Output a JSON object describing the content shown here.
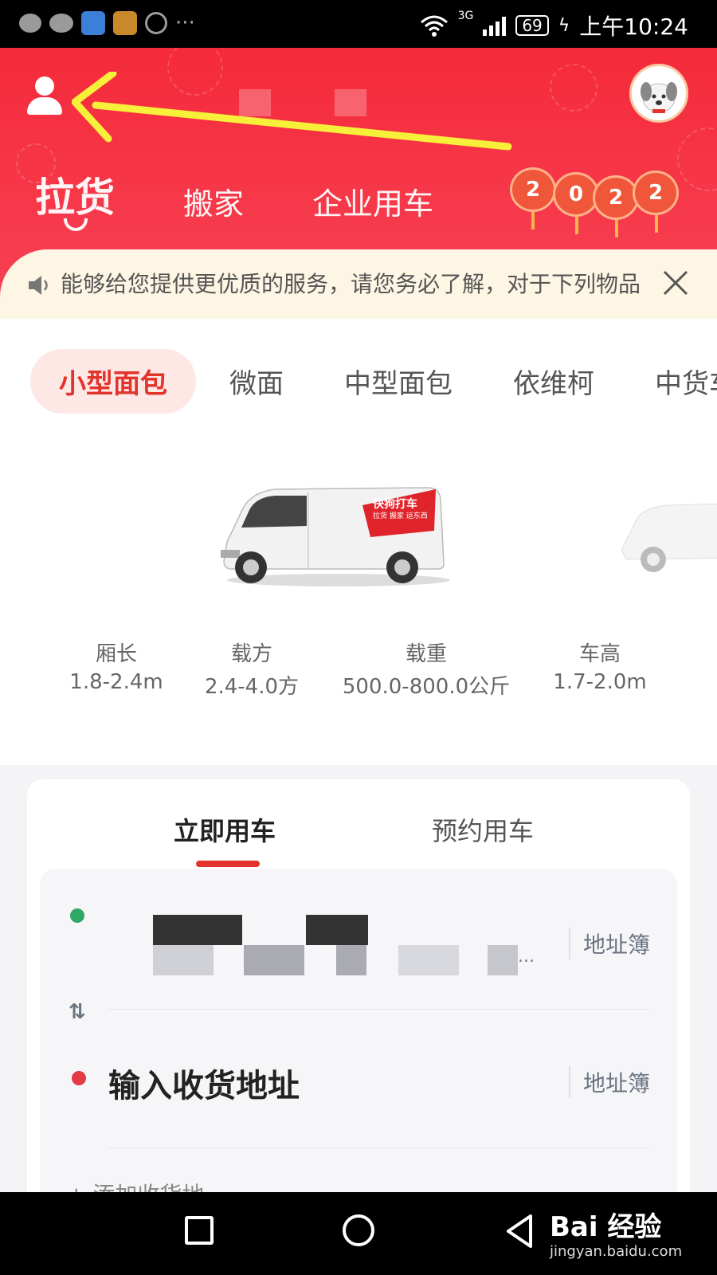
{
  "status_bar": {
    "time": "上午10:24",
    "battery": "69",
    "network": "3G",
    "more": "···"
  },
  "header": {
    "tabs": [
      {
        "label": "拉货",
        "active": true
      },
      {
        "label": "搬家",
        "active": false
      },
      {
        "label": "企业用车",
        "active": false
      }
    ],
    "lantern_text": [
      "2",
      "0",
      "2",
      "2"
    ],
    "brand_color": "#f52a3a"
  },
  "notice": {
    "text": "能够给您提供更优质的服务，请您务必了解，对于下列物品"
  },
  "vehicle_tabs": [
    {
      "label": "小型面包",
      "active": true
    },
    {
      "label": "微面",
      "active": false
    },
    {
      "label": "中型面包",
      "active": false
    },
    {
      "label": "依维柯",
      "active": false
    },
    {
      "label": "中货车",
      "active": false
    }
  ],
  "van_logo": {
    "name": "快狗打车",
    "slogan": "拉货 搬家 运东西"
  },
  "specs": [
    {
      "label": "厢长",
      "value": "1.8-2.4m"
    },
    {
      "label": "载方",
      "value": "2.4-4.0方"
    },
    {
      "label": "载重",
      "value": "500.0-800.0公斤"
    },
    {
      "label": "车高",
      "value": "1.7-2.0m"
    }
  ],
  "order": {
    "tabs": [
      {
        "label": "立即用车",
        "active": true
      },
      {
        "label": "预约用车",
        "active": false
      }
    ],
    "pickup_ellipsis": "...",
    "address_book": "地址簿",
    "swap": "⇅",
    "dropoff_placeholder": "输入收货地址",
    "add_stop": "+ 添加收货地"
  },
  "watermark": {
    "brand": "Bai 经验",
    "url": "jingyan.baidu.com"
  },
  "colors": {
    "accent": "#e2332c",
    "pickup_dot": "#2fa866",
    "dropoff_dot": "#e23a46",
    "notice_bg": "#fdf6e4"
  }
}
